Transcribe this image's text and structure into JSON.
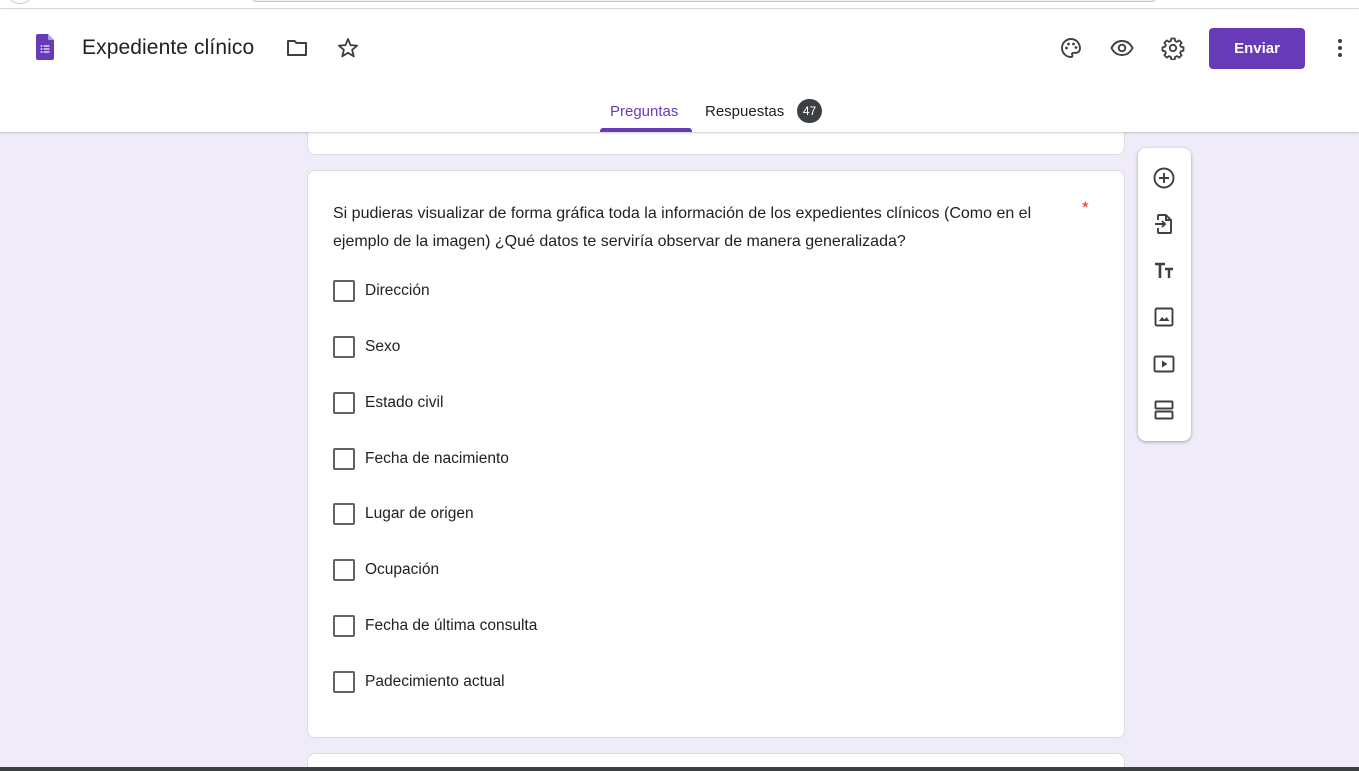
{
  "header": {
    "title": "Expediente clínico",
    "send_label": "Enviar"
  },
  "tabs": [
    {
      "label": "Preguntas",
      "active": true
    },
    {
      "label": "Respuestas",
      "badge": "47"
    }
  ],
  "icons": {
    "logo": "forms-logo-icon",
    "folder": "folder-icon",
    "star": "star-icon",
    "palette": "palette-icon",
    "preview": "eye-icon",
    "settings": "gear-icon",
    "more": "more-vert-icon"
  },
  "question": {
    "text": "Si pudieras visualizar de forma gráfica toda la información de los expedientes clínicos  (Como en el ejemplo de la imagen) ¿Qué datos te serviría observar de manera generalizada?",
    "required_mark": "*",
    "options": [
      "Dirección",
      "Sexo",
      "Estado civil",
      "Fecha de nacimiento",
      "Lugar de origen",
      "Ocupación",
      "Fecha de última consulta",
      "Padecimiento actual"
    ]
  },
  "side_toolbar": [
    "add-question-icon",
    "import-questions-icon",
    "add-title-icon",
    "add-image-icon",
    "add-video-icon",
    "add-section-icon"
  ],
  "colors": {
    "accent": "#673ab7",
    "background": "#f0ebf8",
    "required": "#d93025"
  }
}
